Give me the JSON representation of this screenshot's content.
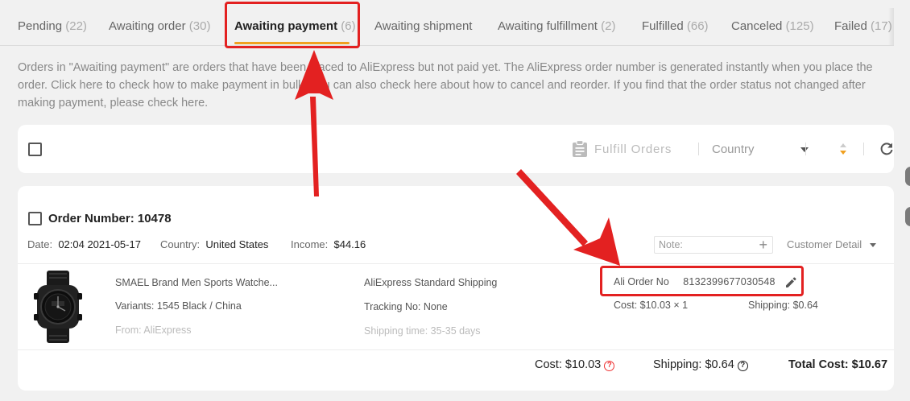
{
  "tabs": [
    {
      "label": "Pending",
      "count": "(22)"
    },
    {
      "label": "Awaiting order",
      "count": "(30)"
    },
    {
      "label": "Awaiting payment",
      "count": "(6)"
    },
    {
      "label": "Awaiting shipment",
      "count": ""
    },
    {
      "label": "Awaiting fulfillment",
      "count": "(2)"
    },
    {
      "label": "Fulfilled",
      "count": "(66)"
    },
    {
      "label": "Canceled",
      "count": "(125)"
    },
    {
      "label": "Failed",
      "count": "(17)"
    }
  ],
  "active_tab": "Awaiting payment",
  "description": "Orders in \"Awaiting payment\" are orders that have been placed to AliExpress but not paid yet. The AliExpress order number is generated instantly when you place the order. Click here to check how to make payment in bulk. You can also check here about how to cancel and reorder. If you find that the order status not changed after making payment, please check here.",
  "toolbar": {
    "fulfill_label": "Fulfill Orders",
    "country_label": "Country"
  },
  "order": {
    "title": "Order Number: 10478",
    "date_label": "Date:",
    "date_value": "02:04 2021-05-17",
    "country_label": "Country:",
    "country_value": "United States",
    "income_label": "Income:",
    "income_value": "$44.16",
    "note_placeholder": "Note:",
    "customer_detail": "Customer Detail",
    "product": {
      "name": "SMAEL Brand Men Sports Watche...",
      "variants": "Variants: 1545 Black / China",
      "from": "From: AliExpress",
      "shipping_method": "AliExpress Standard Shipping",
      "tracking": "Tracking No: None",
      "shipping_time": "Shipping time: 35-35 days",
      "ali_order_label": "Ali Order No",
      "ali_order_number": "8132399677030548",
      "cost": "Cost: $10.03 × 1",
      "shipping_cost": "Shipping: $0.64"
    },
    "totals": {
      "cost": "Cost: $10.03",
      "shipping": "Shipping: $0.64",
      "total": "Total Cost: $10.67"
    }
  },
  "colors": {
    "accent_underline": "#f0a020",
    "annotation_red": "#e32121"
  }
}
